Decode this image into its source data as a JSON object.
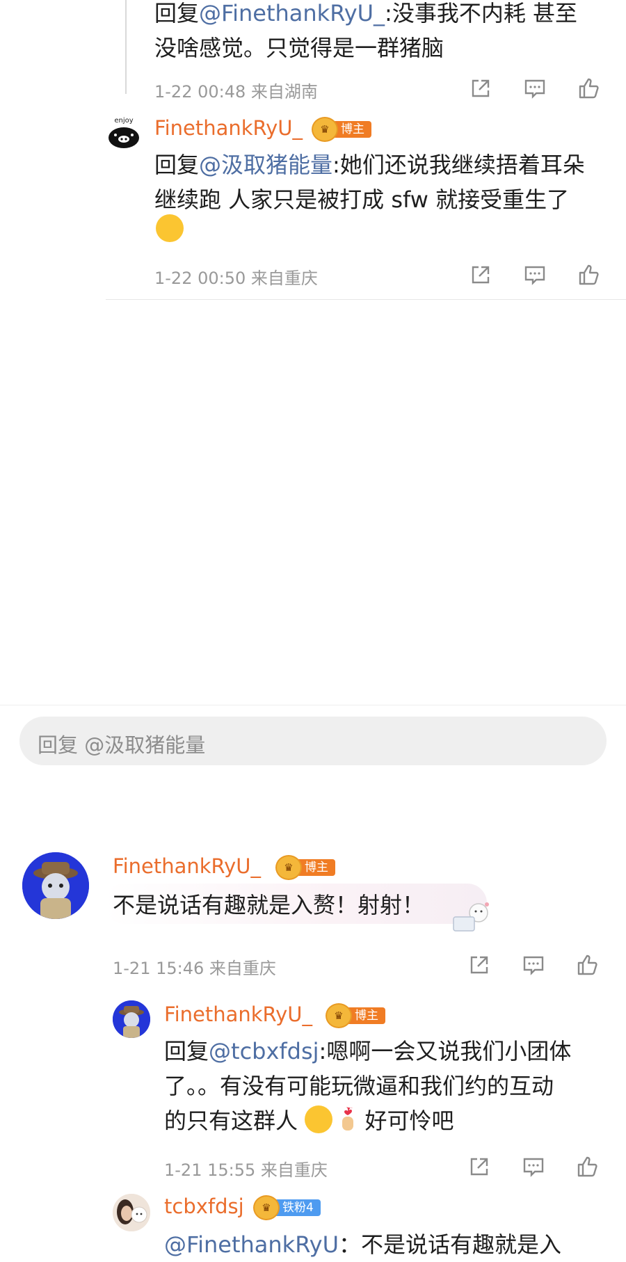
{
  "top_reply": {
    "line1_prefix": "回复",
    "line1_mention": "@FinethankRyU_",
    "line1_text": ":没事我不内耗 甚至",
    "line2": "没啥感觉。只觉得是一群猪脑",
    "meta": "1-22 00:48 来自湖南"
  },
  "reply2": {
    "avatar_text": "enjoy",
    "username": "FinethankRyU_",
    "badge": "博主",
    "line1_prefix": "回复",
    "line1_mention": "@汲取猪能量",
    "line1_text": ":她们还说我继续捂着耳朵",
    "line2": "继续跑  人家只是被打成 sfw 就接受重生了",
    "meta": "1-22 00:50 来自重庆"
  },
  "reply_input": {
    "placeholder": "回复 @汲取猪能量"
  },
  "comment_main": {
    "username": "FinethankRyU_",
    "badge": "博主",
    "text": "不是说话有趣就是入赘！射射！",
    "meta": "1-21 15:46 来自重庆"
  },
  "sub_reply1": {
    "username": "FinethankRyU_",
    "badge": "博主",
    "line1_prefix": "回复",
    "line1_mention": "@tcbxfdsj",
    "line1_text": ":嗯啊一会又说我们小团体",
    "line2": "了。。有没有可能玩微逼和我们约的互动",
    "line3_a": "的只有这群人",
    "line3_b": "好可怜吧",
    "meta": "1-21 15:55 来自重庆"
  },
  "sub_reply2": {
    "username": "tcbxfdsj",
    "badge": "铁粉4",
    "line1_mention": "@FinethankRyU",
    "line1_text": "：不是说话有趣就是入"
  },
  "icons": [
    "share-icon",
    "comment-icon",
    "like-icon"
  ],
  "colors": {
    "username": "#ea6d2c",
    "mention": "#4e6ea3",
    "meta": "#999999",
    "badge_blogger": "#f07c24",
    "badge_fan": "#4e9bf0"
  }
}
